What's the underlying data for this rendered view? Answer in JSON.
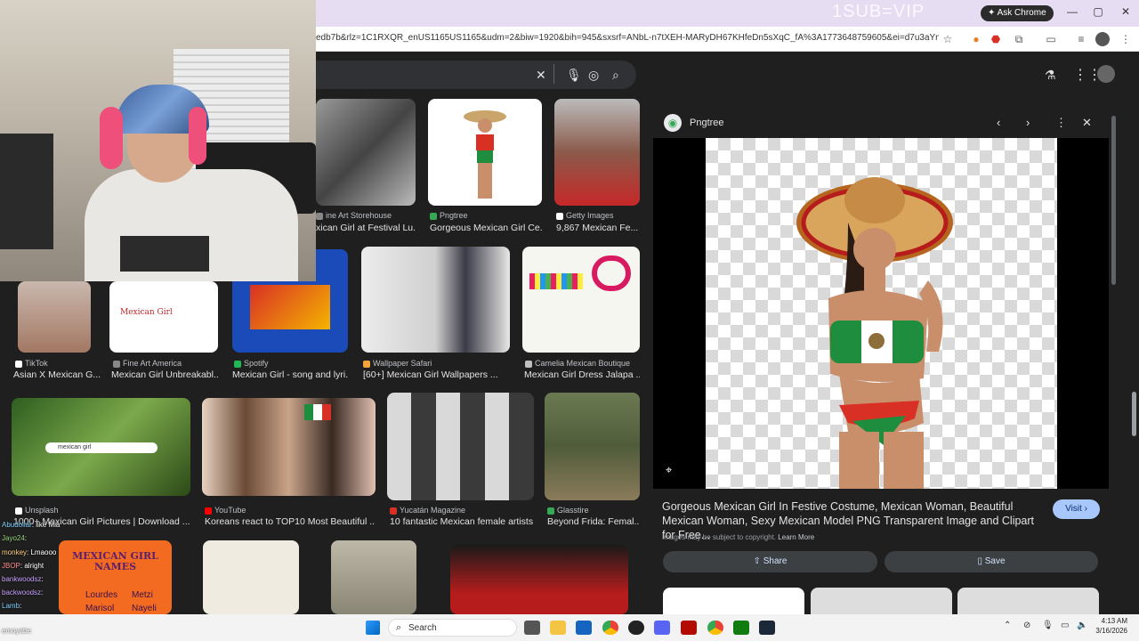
{
  "overlay": {
    "promo_text": "1SUB=VIP"
  },
  "browser": {
    "ask_chrome_label": "Ask Chrome",
    "url": "edb7b&rlz=1C1RXQR_enUS1165US1165&udm=2&biw=1920&bih=945&sxsrf=ANbL-n7tXEH-MARyDH67KHfeDn5sXqC_fA%3A1773648759605&ei=d7u3aYnTJM6X5O...",
    "window_controls": [
      "—",
      "▢",
      "✕"
    ]
  },
  "results": {
    "row1": [
      {
        "source": "ine Art Storehouse",
        "title": "xican Girl at Festival Lu...",
        "source_color": "#888888"
      },
      {
        "source": "Pngtree",
        "title": "Gorgeous Mexican Girl Ce...",
        "source_color": "#34a853"
      },
      {
        "source": "Getty Images",
        "title": "9,867 Mexican Fe...",
        "source_color": "#ffffff"
      }
    ],
    "row2": [
      {
        "source": "TikTok",
        "title": "Asian X Mexican G...",
        "source_color": "#ffffff"
      },
      {
        "source": "Fine Art America",
        "title": "Mexican Girl Unbreakabl...",
        "source_color": "#888888"
      },
      {
        "source": "Spotify",
        "title": "Mexican Girl - song and lyri...",
        "source_color": "#1db954"
      },
      {
        "source": "Wallpaper Safari",
        "title": "[60+] Mexican Girl Wallpapers ...",
        "source_color": "#f4a23c"
      },
      {
        "source": "Camelia Mexican Boutique",
        "title": "Mexican Girl Dress Jalapa ...",
        "source_color": "#c0c0c0"
      }
    ],
    "row3": [
      {
        "source": "Unsplash",
        "title": "1000+ Mexican Girl Pictures | Download ...",
        "source_color": "#ffffff"
      },
      {
        "source": "YouTube",
        "title": "Koreans react to TOP10 Most Beautiful ...",
        "source_color": "#ff0000"
      },
      {
        "source": "Yucatán Magazine",
        "title": "10 fantastic Mexican female artists...",
        "source_color": "#d93025"
      },
      {
        "source": "Glasstire",
        "title": "Beyond Frida: Femal...",
        "source_color": "#34a853"
      }
    ],
    "thumb_texts": {
      "mexican_girl_label": "Mexican Girl",
      "search_chip": "mexican girl",
      "names_poster_title": "MEXICAN GIRL NAMES",
      "names_poster_names": [
        "Lourdes",
        "Metzi",
        "Marisol",
        "Nayeli"
      ]
    }
  },
  "panel": {
    "source_name": "Pngtree",
    "title": "Gorgeous Mexican Girl In Festive Costume, Mexican Woman, Beautiful Mexican Woman, Sexy Mexican Model PNG Transparent Image and Clipart for Free...",
    "visit_label": "Visit",
    "copyright_note": "Images may be subject to copyright.",
    "learn_more": "Learn More",
    "share_label": "Share",
    "save_label": "Save"
  },
  "chat": [
    {
      "user": "Abudollar",
      "msg": "like Mia"
    },
    {
      "user": "Jayo24",
      "msg": ""
    },
    {
      "user": "monkey",
      "msg": "Lmaooo"
    },
    {
      "user": "JBOP",
      "msg": "alright"
    },
    {
      "user": "bankwoodsz",
      "msg": ""
    },
    {
      "user": "backwoodsz",
      "msg": ""
    },
    {
      "user": "Lamb",
      "msg": ""
    },
    {
      "user": "bankwoodsz",
      "msg": ""
    },
    {
      "user": "",
      "msg": "emoyabe"
    }
  ],
  "taskbar": {
    "search_label": "Search",
    "time": "4:13 AM",
    "date": "3/16/2026"
  },
  "colors": {
    "google_bg": "#1f1f1f",
    "panel_button": "#3c4043",
    "visit_button": "#a8c7fa",
    "titlebar": "#e6ddf2"
  }
}
